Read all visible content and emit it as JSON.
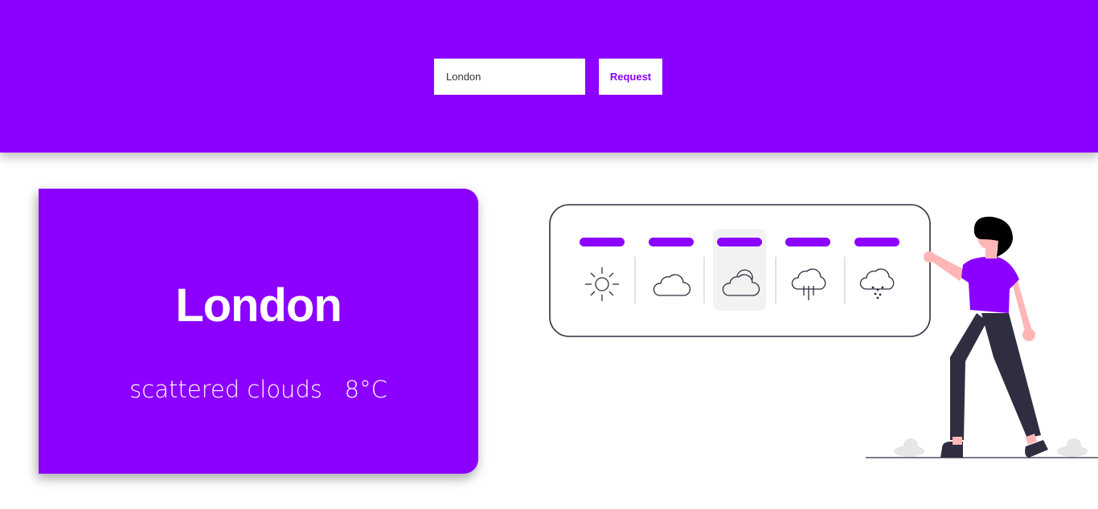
{
  "search": {
    "value": "London",
    "button_label": "Request"
  },
  "weather": {
    "city": "London",
    "description": "scattered clouds",
    "temperature": "8°C"
  },
  "illustration": {
    "icons": [
      "sun-icon",
      "cloud-icon",
      "partly-cloudy-icon",
      "rain-icon",
      "snow-icon"
    ],
    "selected_index": 2
  },
  "colors": {
    "accent": "#8c00ff",
    "ink": "#2f2e41",
    "skin": "#ffb6b6"
  }
}
